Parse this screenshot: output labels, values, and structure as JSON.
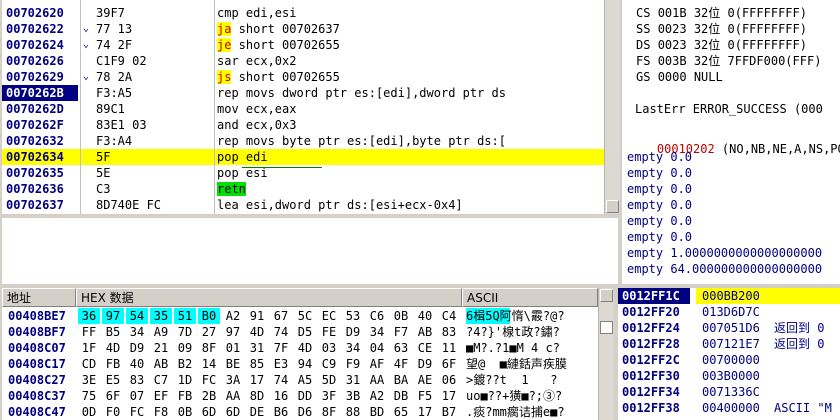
{
  "disasm": {
    "rows": [
      {
        "addr": "00702620",
        "mark": "",
        "hex": "39F7",
        "instr": "cmp edi,esi",
        "hl": "none"
      },
      {
        "addr": "00702622",
        "mark": "⌄",
        "hex": "77 13",
        "op": "ja",
        "rest": " short 00702637",
        "hl": "jump"
      },
      {
        "addr": "00702624",
        "mark": "⌄",
        "hex": "74 2F",
        "op": "je",
        "rest": " short 00702655",
        "hl": "jump"
      },
      {
        "addr": "00702626",
        "mark": "",
        "hex": "C1F9 02",
        "instr": "sar ecx,0x2",
        "hl": "none"
      },
      {
        "addr": "00702629",
        "mark": "⌄",
        "hex": "78 2A",
        "op": "js",
        "rest": " short 00702655",
        "hl": "jump"
      },
      {
        "addr": "0070262B",
        "mark": "",
        "hex": "F3:A5",
        "instr": "rep movs dword ptr es:[edi],dword ptr ds",
        "hl": "selected"
      },
      {
        "addr": "0070262D",
        "mark": "",
        "hex": "89C1",
        "instr": "mov ecx,eax",
        "hl": "none"
      },
      {
        "addr": "0070262F",
        "mark": "",
        "hex": "83E1 03",
        "instr": "and ecx,0x3",
        "hl": "none"
      },
      {
        "addr": "00702632",
        "mark": "",
        "hex": "F3:A4",
        "instr": "rep movs byte ptr es:[edi],byte ptr ds:[",
        "hl": "none"
      },
      {
        "addr": "00702634",
        "mark": "",
        "hex": "5F",
        "instr": "pop edi",
        "hl": "current"
      },
      {
        "addr": "00702635",
        "mark": "",
        "hex": "5E",
        "instr": "pop esi",
        "hl": "none"
      },
      {
        "addr": "00702636",
        "mark": "",
        "hex": "C3",
        "op": "retn",
        "rest": "",
        "hl": "ret"
      },
      {
        "addr": "00702637",
        "mark": "",
        "hex": "8D740E FC",
        "instr": "lea esi,dword ptr ds:[esi+ecx-0x4]",
        "hl": "none"
      }
    ]
  },
  "registers": {
    "segs": [
      {
        "name": "CS",
        "sel": "001B",
        "bits": "32位",
        "base": "0(FFFFFFFF)"
      },
      {
        "name": "SS",
        "sel": "0023",
        "bits": "32位",
        "base": "0(FFFFFFFF)"
      },
      {
        "name": "DS",
        "sel": "0023",
        "bits": "32位",
        "base": "0(FFFFFFFF)"
      },
      {
        "name": "FS",
        "sel": "003B",
        "bits": "32位",
        "base": "7FFDF000(FFF)"
      },
      {
        "name": "GS",
        "sel": "0000",
        "bits": "",
        "base": "NULL"
      }
    ],
    "lasterr": "LastErr ERROR_SUCCESS (000",
    "eflags_val": "00010202",
    "eflags_flags": " (NO,NB,NE,A,NS,PO,",
    "fpu": [
      "empty 0.0",
      "empty 0.0",
      "empty 0.0",
      "empty 0.0",
      "empty 0.0",
      "empty 0.0",
      "empty 1.0000000000000000000",
      "empty 64.000000000000000000"
    ]
  },
  "dump": {
    "col_addr": "地址",
    "col_hex": "HEX 数据",
    "col_ascii": "ASCII",
    "rows": [
      {
        "addr": "00408BE7",
        "bytes": [
          "36",
          "97",
          "54",
          "35",
          "51",
          "B0",
          "A2",
          "91",
          "67",
          "5C",
          "EC",
          "53",
          "C6",
          "0B",
          "40",
          "C4"
        ],
        "ascii": "6楫5Q阿惰\\霰?@?"
      },
      {
        "addr": "00408BF7",
        "bytes": [
          "FF",
          "B5",
          "34",
          "A9",
          "7D",
          "27",
          "97",
          "4D",
          "74",
          "D5",
          "FE",
          "D9",
          "34",
          "F7",
          "AB",
          "83"
        ],
        "ascii": "?4?}'楾t政?鏽?"
      },
      {
        "addr": "00408C07",
        "bytes": [
          "1F",
          "4D",
          "D9",
          "21",
          "09",
          "8F",
          "01",
          "31",
          "7F",
          "4D",
          "03",
          "34",
          "04",
          "63",
          "CE",
          "11"
        ],
        "ascii": "■M?.?1■M 4 c?"
      },
      {
        "addr": "00408C17",
        "bytes": [
          "CD",
          "FB",
          "40",
          "AB",
          "B2",
          "14",
          "BE",
          "85",
          "E3",
          "94",
          "C9",
          "F9",
          "AF",
          "4F",
          "D9",
          "6F"
        ],
        "ascii": "望@  ■縺銛声疾膜"
      },
      {
        "addr": "00408C27",
        "bytes": [
          "3E",
          "E5",
          "83",
          "C7",
          "1D",
          "FC",
          "3A",
          "17",
          "74",
          "A5",
          "5D",
          "31",
          "AA",
          "BA",
          "AE",
          "06"
        ],
        "ascii": ">鍍??t  1   ?"
      },
      {
        "addr": "00408C37",
        "bytes": [
          "75",
          "6F",
          "07",
          "EF",
          "FB",
          "2B",
          "AA",
          "8D",
          "16",
          "DD",
          "3F",
          "3B",
          "A2",
          "DB",
          "F5",
          "17"
        ],
        "ascii": "uo■??+獚■?;③?"
      },
      {
        "addr": "00408C47",
        "bytes": [
          "0D",
          "F0",
          "FC",
          "F8",
          "0B",
          "6D",
          "6D",
          "DE",
          "B6",
          "D6",
          "8F",
          "88",
          "BD",
          "65",
          "17",
          "B7"
        ],
        "ascii": ".痰?mm瘸诘捕e■?"
      }
    ]
  },
  "stack": {
    "rows": [
      {
        "addr": "0012FF1C",
        "val": "000BB200",
        "comment": "",
        "selected": true
      },
      {
        "addr": "0012FF20",
        "val": "013D6D7C",
        "comment": "",
        "selected": false
      },
      {
        "addr": "0012FF24",
        "val": "007051D6",
        "comment": "返回到 0",
        "selected": false
      },
      {
        "addr": "0012FF28",
        "val": "007121E7",
        "comment": "返回到 0",
        "selected": false
      },
      {
        "addr": "0012FF2C",
        "val": "00700000",
        "comment": "",
        "selected": false
      },
      {
        "addr": "0012FF30",
        "val": "003B0000",
        "comment": "",
        "selected": false
      },
      {
        "addr": "0012FF34",
        "val": "0071336C",
        "comment": "",
        "selected": false
      },
      {
        "addr": "0012FF38",
        "val": "00400000",
        "comment": "ASCII \"M",
        "selected": false
      }
    ]
  }
}
